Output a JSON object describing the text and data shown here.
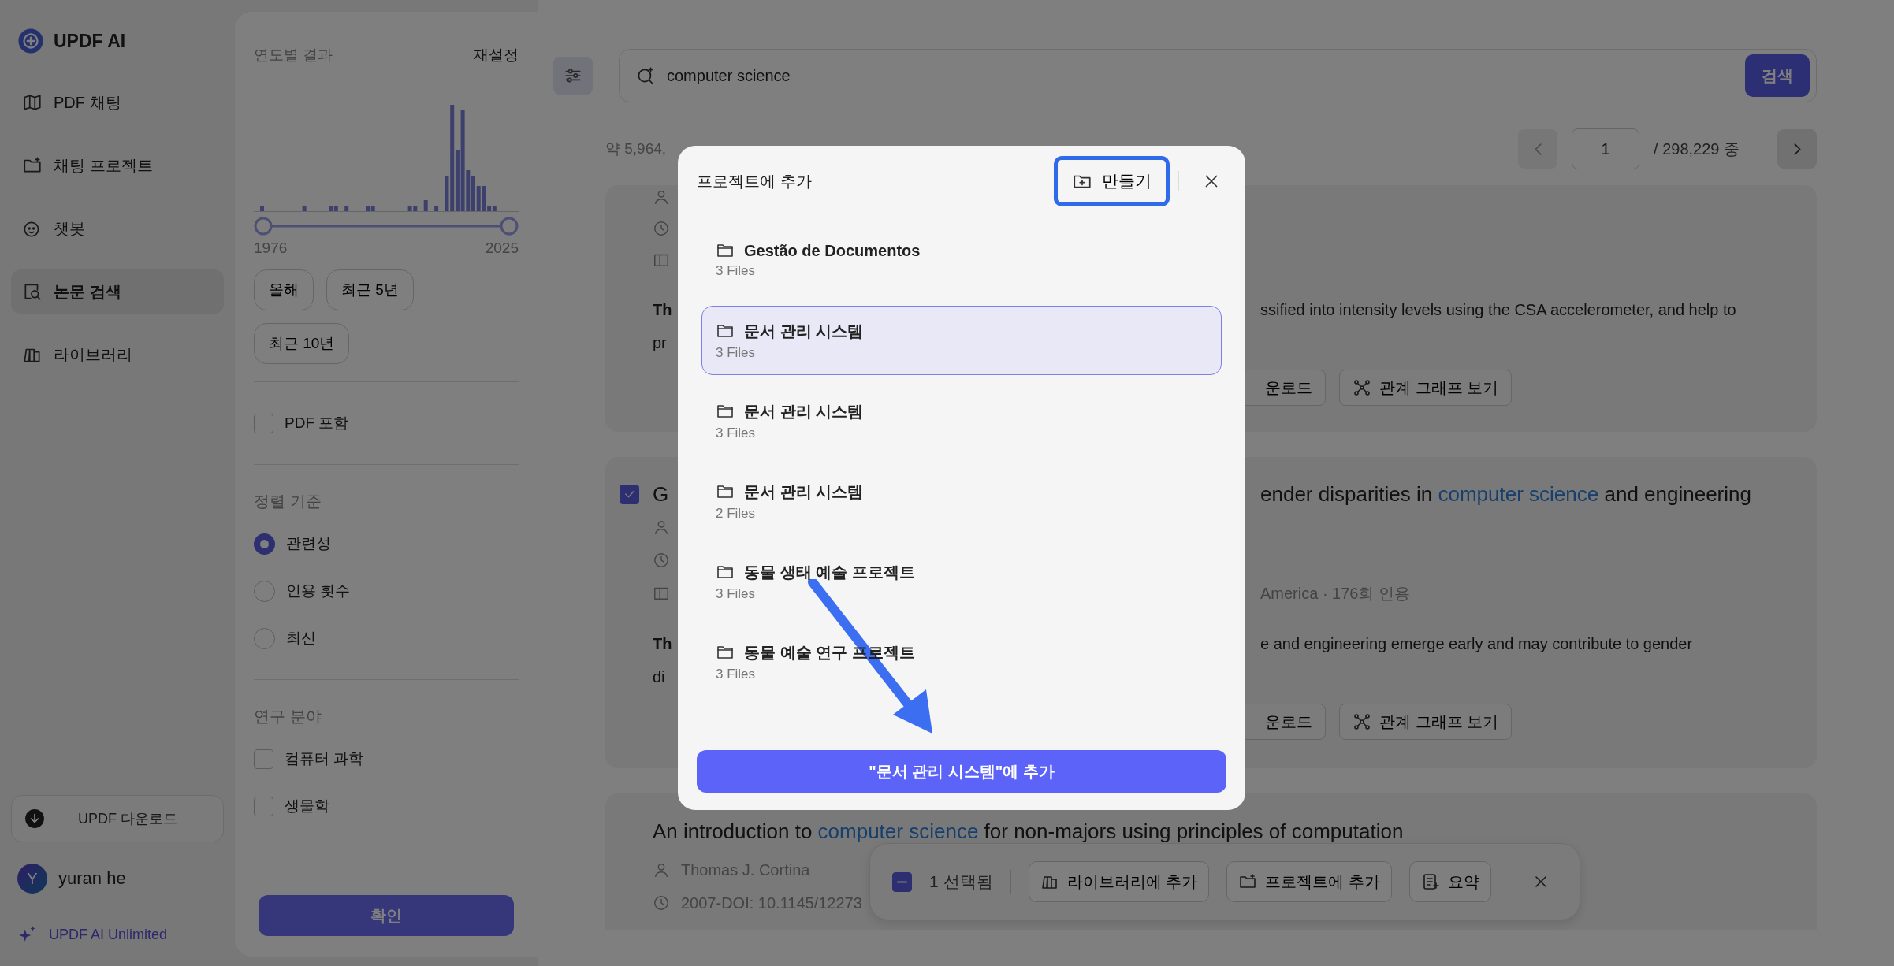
{
  "app": {
    "name": "UPDF AI"
  },
  "nav": [
    {
      "label": "PDF 채팅",
      "selected": false
    },
    {
      "label": "채팅 프로젝트",
      "selected": false
    },
    {
      "label": "챗봇",
      "selected": false
    },
    {
      "label": "논문 검색",
      "selected": true
    },
    {
      "label": "라이브러리",
      "selected": false
    }
  ],
  "download_button": "UPDF 다운로드",
  "user": {
    "initial": "Y",
    "name": "yuran he"
  },
  "plan": "UPDF AI Unlimited",
  "filters": {
    "year_title": "연도별 결과",
    "reset": "재설정",
    "slider": {
      "thumbs": [
        {
          "level": 0
        },
        {
          "level": 1
        }
      ],
      "min_label": "1976",
      "max_label": "2025"
    },
    "presets": [
      {
        "label": "올해",
        "selected": false
      },
      {
        "label": "최근 5년",
        "selected": false
      },
      {
        "label": "최근 10년",
        "selected": false
      }
    ],
    "pdf_only": {
      "label": "PDF 포함",
      "checked": false
    },
    "sort_title": "정렬 기준",
    "sort_options": [
      {
        "label": "관련성",
        "selected": true
      },
      {
        "label": "인용 횟수",
        "selected": false
      },
      {
        "label": "최신",
        "selected": false
      }
    ],
    "field_title": "연구 분야",
    "fields": [
      {
        "label": "컴퓨터 과학",
        "checked": false
      },
      {
        "label": "생물학",
        "checked": false
      }
    ],
    "confirm": "확인"
  },
  "search": {
    "value": "computer science",
    "button": "검색"
  },
  "results_count": "약 5,964,",
  "pagination": {
    "page": "1",
    "total": "/ 298,229 중"
  },
  "results": [
    {
      "abstract": [
        {
          "label": "Th",
          "right": "ssified into intensity levels using the CSA accelerometer, and help to"
        },
        {
          "left": "pr"
        }
      ],
      "actions": [
        "운로드",
        "관계 그래프 보기"
      ]
    },
    {
      "checked": true,
      "title_left": "G",
      "title_right": [
        {
          "text": "ender disparities in ",
          "highlight": false
        },
        {
          "text": "computer science",
          "highlight": true
        },
        {
          "text": " and engineering",
          "highlight": false
        }
      ],
      "citation": "America · 176회 인용",
      "abstract": [
        {
          "label": "Th",
          "right": "e and engineering emerge early and may contribute to gender"
        },
        {
          "left": "di"
        }
      ],
      "actions": [
        "운로드",
        "관계 그래프 보기"
      ]
    },
    {
      "title": [
        {
          "text": "An introduction to ",
          "highlight": false
        },
        {
          "text": "computer science",
          "highlight": true
        },
        {
          "text": " for non-majors using principles of computation",
          "highlight": false
        }
      ],
      "author": "Thomas J. Cortina",
      "date": "2007-DOI: 10.1145/12273"
    }
  ],
  "selection_bar": {
    "indeterminate": true,
    "count": "1 선택됨",
    "actions": [
      "라이브러리에 추가",
      "프로젝트에 추가",
      "요약"
    ]
  },
  "modal": {
    "title": "프로젝트에 추가",
    "create": "만들기",
    "projects": [
      {
        "name": "Gestão de Documentos",
        "count": "3 Files",
        "selected": false
      },
      {
        "name": "문서 관리 시스템",
        "count": "3 Files",
        "selected": true
      },
      {
        "name": "문서 관리 시스템",
        "count": "3 Files",
        "selected": false
      },
      {
        "name": "문서 관리 시스템",
        "count": "2 Files",
        "selected": false
      },
      {
        "name": "동물 생태 예술 프로젝트",
        "count": "3 Files",
        "selected": false
      },
      {
        "name": "동물 예술 연구 프로젝트",
        "count": "3 Files",
        "selected": false
      }
    ],
    "add_button": "\"문서 관리 시스템\"에 추가"
  },
  "annotations": {
    "highlight_create": true,
    "arrow": true
  }
}
